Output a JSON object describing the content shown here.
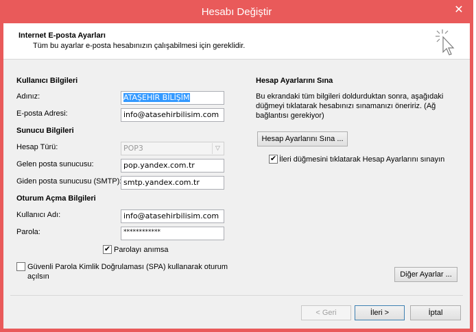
{
  "window": {
    "title": "Hesabı Değiştir",
    "close_glyph": "✕"
  },
  "header": {
    "title": "Internet E-posta Ayarları",
    "subtitle": "Tüm bu ayarlar e-posta hesabınızın çalışabilmesi için gereklidir."
  },
  "user_info": {
    "section": "Kullanıcı Bilgileri",
    "name_label": "Adınız:",
    "name_value": "ATAŞEHİR BİLİŞİM",
    "email_label": "E-posta Adresi:",
    "email_value": "info@atasehirbilisim.com"
  },
  "server_info": {
    "section": "Sunucu Bilgileri",
    "account_type_label": "Hesap Türü:",
    "account_type_value": "POP3",
    "incoming_label": "Gelen posta sunucusu:",
    "incoming_value": "pop.yandex.com.tr",
    "outgoing_label": "Giden posta sunucusu (SMTP):",
    "outgoing_value": "smtp.yandex.com.tr"
  },
  "logon_info": {
    "section": "Oturum Açma Bilgileri",
    "username_label": "Kullanıcı Adı:",
    "username_value": "info@atasehirbilisim.com",
    "password_label": "Parola:",
    "password_value": "************",
    "remember_label": "Parolayı anımsa",
    "remember_checked": true,
    "spa_label": "Güvenli Parola Kimlik Doğrulaması (SPA) kullanarak oturum açılsın",
    "spa_checked": false
  },
  "test_settings": {
    "section": "Hesap Ayarlarını Sına",
    "description": "Bu ekrandaki tüm bilgileri doldurduktan sonra, aşağıdaki düğmeyi tıklatarak hesabınızı sınamanızı öneririz. (Ağ bağlantısı gerekiyor)",
    "test_button": "Hesap Ayarlarını Sına ...",
    "auto_test_label": "İleri düğmesini tıklatarak Hesap Ayarlarını sınayın",
    "auto_test_checked": true,
    "more_settings_button": "Diğer Ayarlar ..."
  },
  "footer": {
    "back_button": "< Geri",
    "next_button": "İleri >",
    "cancel_button": "İptal"
  },
  "colors": {
    "titlebar": "#e95a5a",
    "selection": "#3399ff"
  }
}
